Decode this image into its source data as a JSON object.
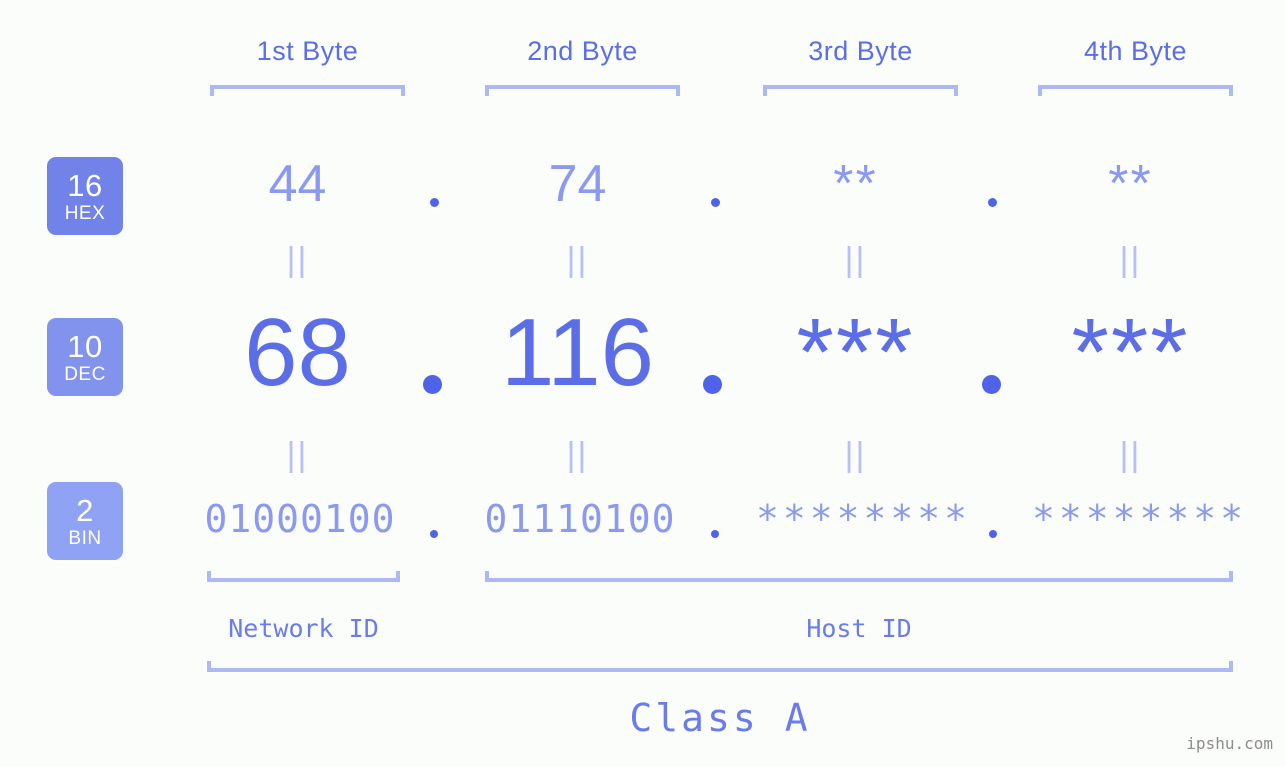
{
  "background_color": "#fafdfa",
  "colors": {
    "header_text": "#5b6ee8",
    "bracket": "#adb9f5",
    "hex_value": "#8b9af0",
    "dec_value": "#5b6ee8",
    "bin_value": "#8b9af0",
    "dot": "#4f63e8",
    "equals_mark": "#b6c0f7",
    "badge_hex": "#7183e8",
    "badge_dec": "#8293ed",
    "badge_bin": "#8fa2f3",
    "badge_text": "#ffffff",
    "section_label": "#6b7ce8",
    "watermark": "#8d8d8d"
  },
  "byte_headers": [
    {
      "label": "1st Byte"
    },
    {
      "label": "2nd Byte"
    },
    {
      "label": "3rd Byte"
    },
    {
      "label": "4th Byte"
    }
  ],
  "bases": [
    {
      "number": "16",
      "name": "HEX",
      "color": "#7183e8"
    },
    {
      "number": "10",
      "name": "DEC",
      "color": "#8293ed"
    },
    {
      "number": "2",
      "name": "BIN",
      "color": "#8fa2f3"
    }
  ],
  "rows": {
    "hex": {
      "base_number": "16",
      "base_name": "HEX",
      "values": [
        "44",
        "74",
        "**",
        "**"
      ]
    },
    "dec": {
      "base_number": "10",
      "base_name": "DEC",
      "values": [
        "68",
        "116",
        "***",
        "***"
      ]
    },
    "bin": {
      "base_number": "2",
      "base_name": "BIN",
      "values": [
        "01000100",
        "01110100",
        "********",
        "********"
      ]
    }
  },
  "separator": ".",
  "equals_mark": "||",
  "sections": {
    "network_id": "Network ID",
    "host_id": "Host ID",
    "class": "Class A"
  },
  "watermark": "ipshu.com"
}
